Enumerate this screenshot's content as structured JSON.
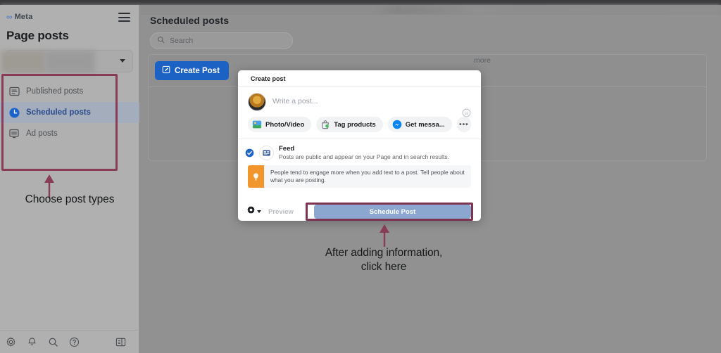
{
  "browser": {
    "chrome_bar": ""
  },
  "sidebar": {
    "brand": {
      "mark": "∞",
      "word": "Meta"
    },
    "menu_icon": "hamburger-icon",
    "page_title": "Page posts",
    "page_picker": {
      "value": "",
      "caret": "chevron-down-icon"
    },
    "items": [
      {
        "label": "Published posts",
        "icon": "published-posts-icon",
        "active": false
      },
      {
        "label": "Scheduled posts",
        "icon": "clock-icon",
        "active": true
      },
      {
        "label": "Ad posts",
        "icon": "ad-posts-icon",
        "active": false
      }
    ],
    "bottom_icons": [
      {
        "name": "gear-icon"
      },
      {
        "name": "bell-icon"
      },
      {
        "name": "search-icon"
      },
      {
        "name": "help-icon"
      },
      {
        "name": "panel-toggle-icon"
      }
    ]
  },
  "annotations": {
    "sidebar_note": "Choose post types",
    "modal_note_line1": "After adding information,",
    "modal_note_line2": "click here",
    "highlight_color": "#8a3b57",
    "arrow_color": "#8a3b57"
  },
  "main": {
    "title": "Scheduled posts",
    "search": {
      "placeholder": "Search",
      "value": "",
      "icon": "search-icon"
    },
    "create_post_button": {
      "label": "Create Post",
      "icon": "compose-icon"
    },
    "more_link": "more"
  },
  "modal": {
    "header": "Create post",
    "avatar": "user-avatar",
    "composer_placeholder": "Write a post...",
    "emoji_icon": "emoji-icon",
    "chips": [
      {
        "label": "Photo/Video",
        "icon": "photo-video-icon"
      },
      {
        "label": "Tag products",
        "icon": "tag-products-icon"
      },
      {
        "label": "Get messa...",
        "icon": "messenger-icon"
      },
      {
        "label": "•••",
        "icon": "more-options-icon"
      }
    ],
    "feed": {
      "title": "Feed",
      "description": "Posts are public and appear on your Page and in search results.",
      "selected": true,
      "check_icon": "check-circle-icon",
      "feed_icon": "feed-icon"
    },
    "tip": {
      "icon": "lightbulb-icon",
      "text": "People tend to engage more when you add text to a post. Tell people about what you are posting."
    },
    "footer": {
      "settings_icon": "gear-icon",
      "settings_caret": "chevron-down-icon",
      "preview_label": "Preview",
      "schedule_label": "Schedule Post",
      "schedule_color": "#8ba7cf"
    }
  },
  "colors": {
    "accent_blue": "#1b62c4",
    "active_nav": "#2a4b8d",
    "overlay_gray": "#919191",
    "tip_orange": "#f0962c"
  }
}
